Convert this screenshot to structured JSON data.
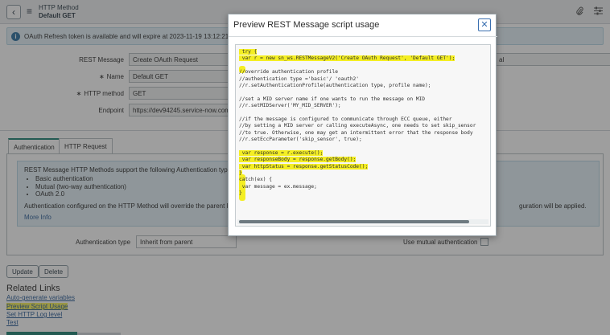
{
  "header": {
    "title_line1": "HTTP Method",
    "title_line2": "Default GET",
    "back_icon": "chevron-left-icon",
    "menu_icon": "hamburger-icon",
    "attach_icon": "paperclip-icon",
    "settings_icon": "sliders-icon"
  },
  "info_message": "OAuth Refresh token is available and will expire at 2023-11-19 13:12:21.",
  "form": {
    "rest_message_label": "REST Message",
    "rest_message_value": "Create OAuth Request",
    "name_label": "Name",
    "name_value": "Default GET",
    "http_method_label": "HTTP method",
    "http_method_value": "GET",
    "endpoint_label": "Endpoint",
    "endpoint_value": "https://dev94245.service-now.com",
    "right_field_value": "al",
    "required_mark": "∗"
  },
  "tabs": [
    {
      "label": "Authentication"
    },
    {
      "label": "HTTP Request"
    }
  ],
  "auth_note": {
    "intro": "REST Message HTTP Methods support the following Authentication types:",
    "types": [
      "Basic authentication",
      "Mutual (two-way authentication)",
      "OAuth 2.0"
    ],
    "override_text": "Authentication configured on the HTTP Method will override the parent REST",
    "override_tail": "guration will be applied.",
    "more_info": "More Info"
  },
  "auth_type": {
    "label": "Authentication type",
    "value": "Inherit from parent"
  },
  "mutual_auth_label": "Use mutual authentication",
  "buttons": {
    "update": "Update",
    "delete": "Delete"
  },
  "related_links": {
    "title": "Related Links",
    "items": [
      "Auto-generate variables",
      "Preview Script Usage",
      "Set HTTP Log level",
      "Test"
    ]
  },
  "modal": {
    "title": "Preview REST Message script usage",
    "close_icon": "close-icon",
    "code_lines": [
      " try {",
      " var r = new sn_ws.RESTMessageV2('Create OAuth Request', 'Default GET');",
      "",
      "//override authentication profile",
      "//authentication type ='basic'/ 'oauth2'",
      "//r.setAuthenticationProfile(authentication type, profile name);",
      "",
      "//set a MID server name if one wants to run the message on MID",
      "//r.setMIDServer('MY_MID_SERVER');",
      "",
      "//if the message is configured to communicate through ECC queue, either",
      "//by setting a MID server or calling executeAsync, one needs to set skip_sensor",
      "//to true. Otherwise, one may get an intermittent error that the response body",
      "//r.setEccParameter('skip_sensor', true);",
      "",
      " var response = r.execute();",
      " var responseBody = response.getBody();",
      " var httpStatus = response.getStatusCode();",
      "}",
      "catch(ex) {",
      " var message = ex.message;",
      "}"
    ],
    "highlight_color": "#f4ee23"
  }
}
